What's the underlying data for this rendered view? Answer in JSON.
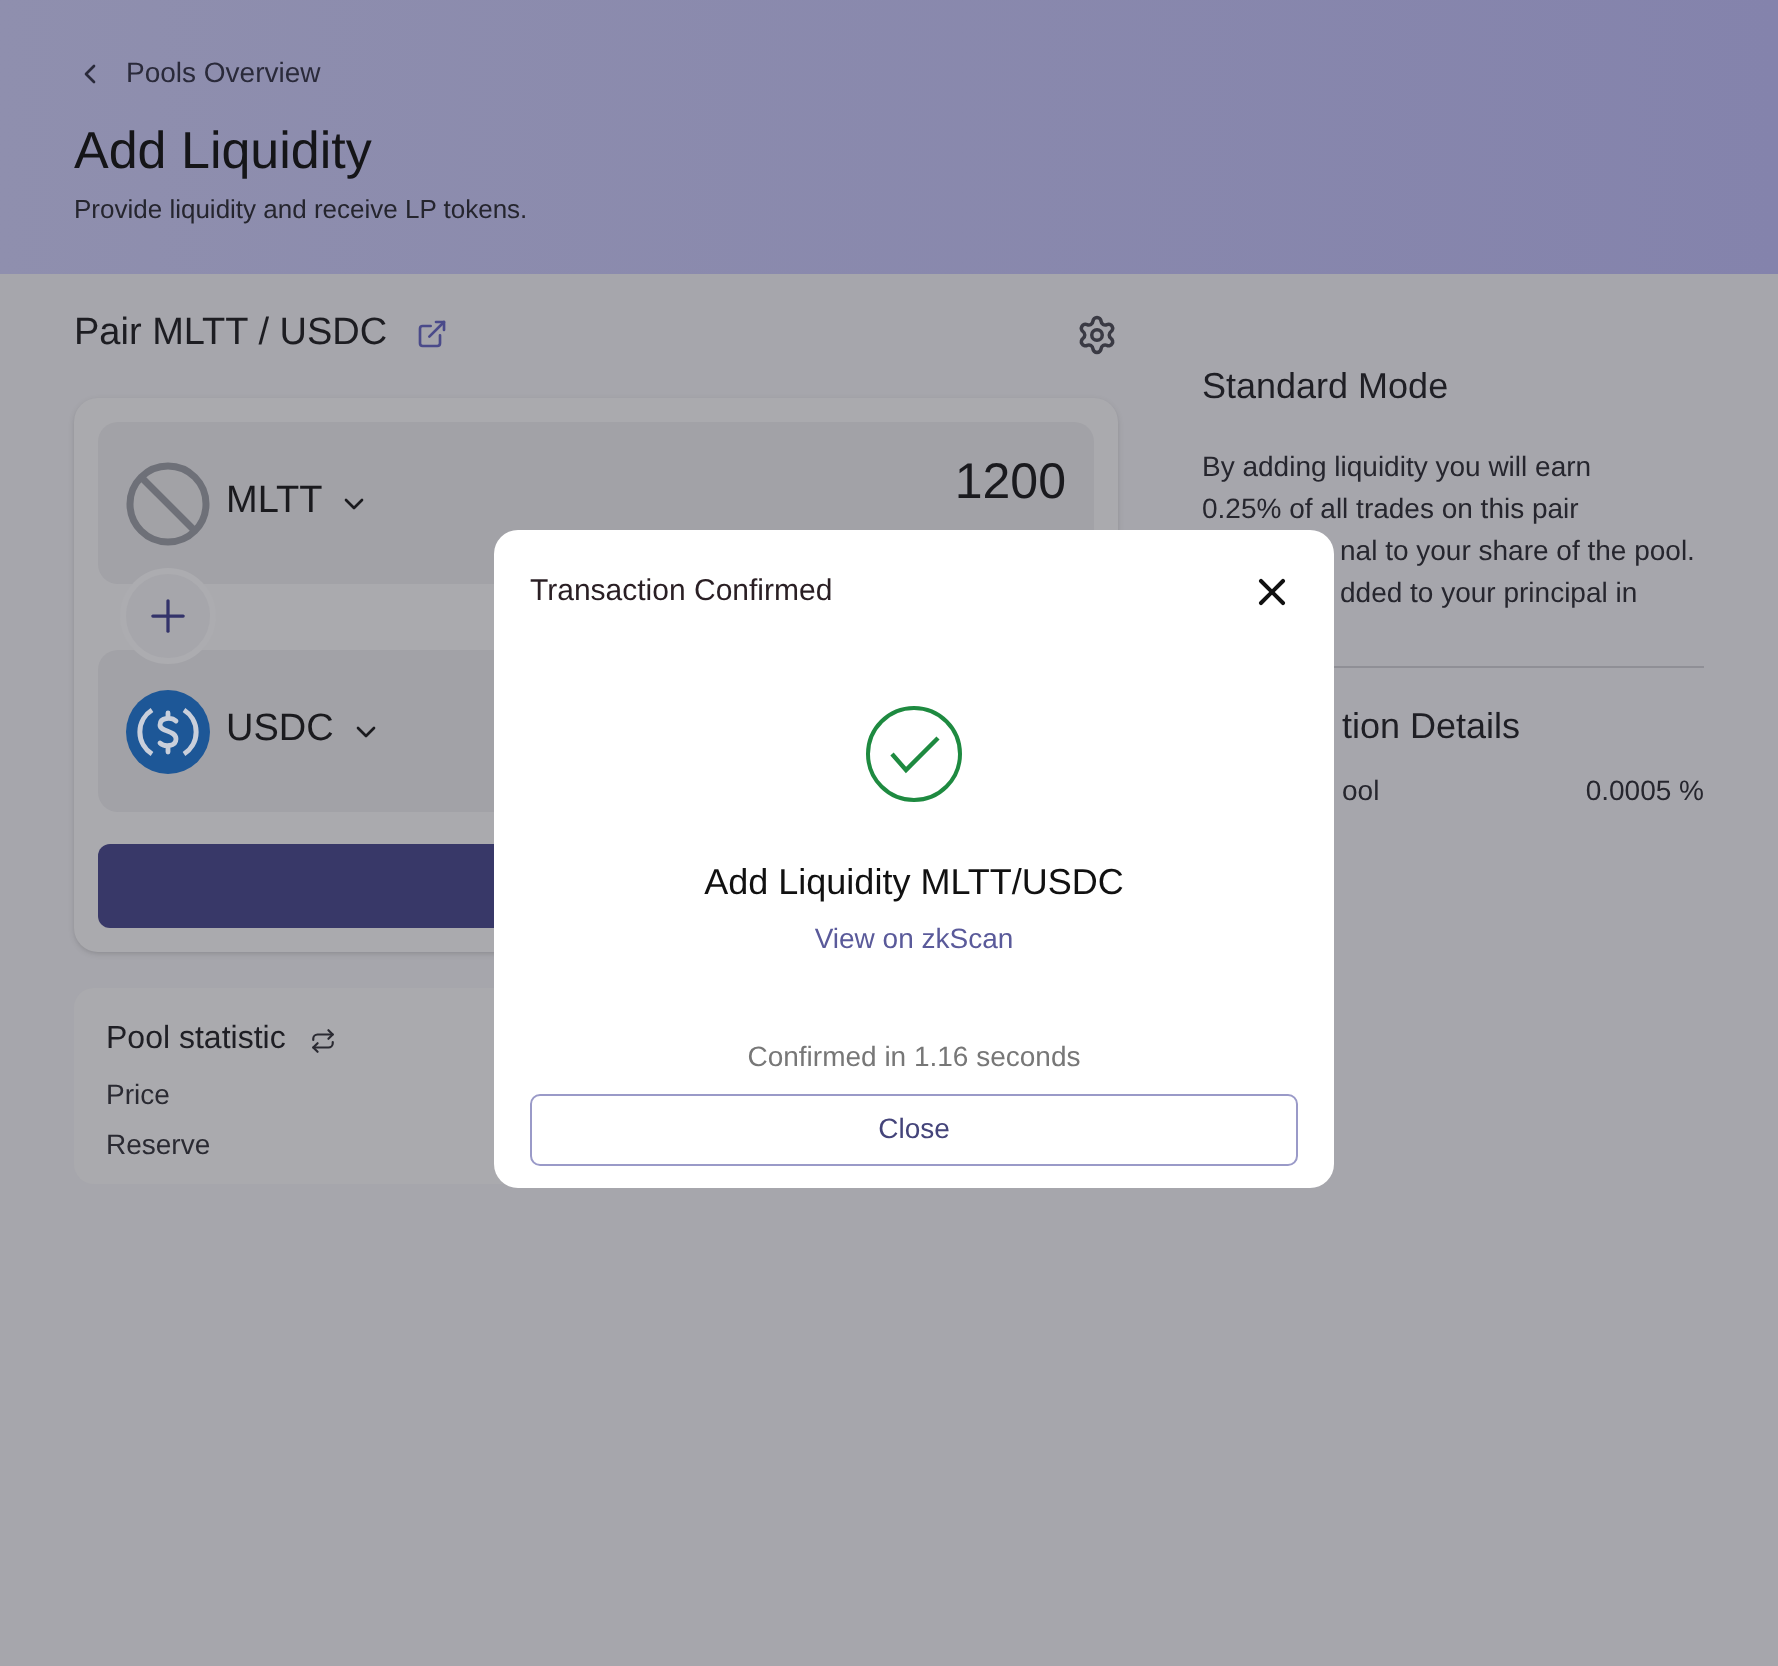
{
  "breadcrumb": {
    "label": "Pools Overview"
  },
  "header": {
    "title": "Add Liquidity",
    "subtitle": "Provide liquidity and receive LP tokens."
  },
  "pair": {
    "title": "Pair MLTT / USDC"
  },
  "tokens": [
    {
      "symbol": "MLTT",
      "kind": "blocked",
      "amount": "1200"
    },
    {
      "symbol": "USDC",
      "kind": "usdc"
    }
  ],
  "pool_statistic": {
    "title": "Pool statistic",
    "rows": [
      "Price",
      "Reserve"
    ]
  },
  "info": {
    "title": "Standard Mode",
    "lines": [
      "By adding liquidity you will earn",
      "0.25% of all trades on this pair"
    ],
    "partial_lines": [
      "nal to your share of the pool.",
      "dded to your principal in"
    ]
  },
  "details": {
    "title": "tion Details",
    "rows": [
      {
        "label": "ool",
        "value": "0.0005 %"
      }
    ]
  },
  "modal": {
    "title": "Transaction Confirmed",
    "heading": "Add Liquidity MLTT/USDC",
    "link": "View on zkScan",
    "note": "Confirmed in 1.16 seconds",
    "button": "Close"
  }
}
